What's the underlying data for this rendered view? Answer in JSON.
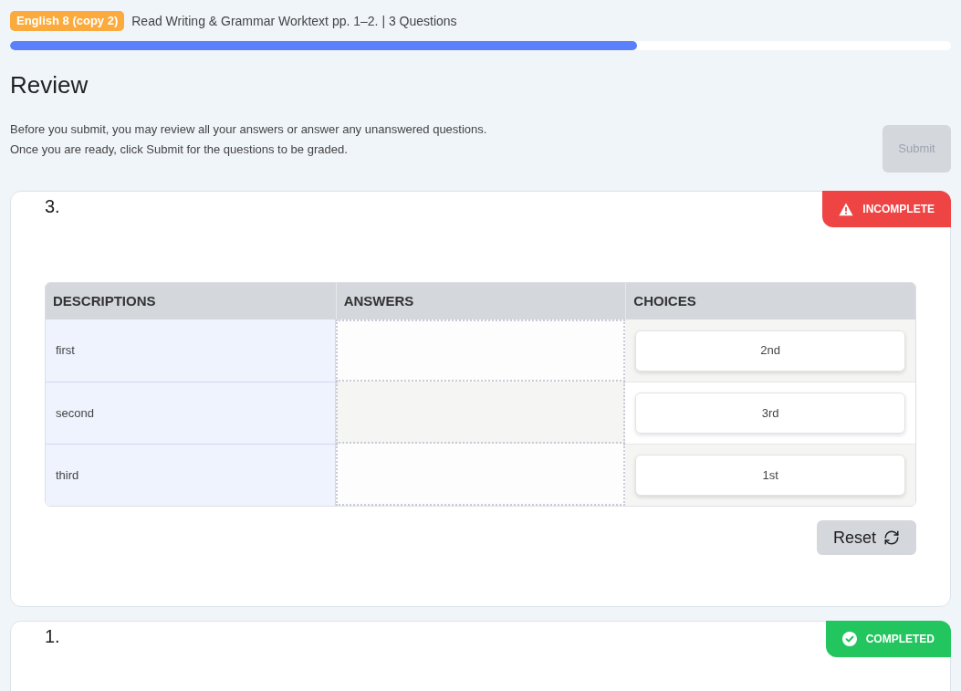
{
  "header": {
    "course_badge": "English 8 (copy 2)",
    "title": "Read Writing & Grammar Worktext pp. 1–2. | 3 Questions",
    "progress": {
      "level": 0.666
    }
  },
  "review": {
    "heading": "Review",
    "instructions": [
      "Before you submit, you may review all your answers or answer any unanswered questions.",
      "Once you are ready, click Submit for the questions to be graded."
    ],
    "submit_button": {
      "label": "Submit",
      "disabled": true
    }
  },
  "questions": [
    {
      "number": "3.",
      "status": {
        "kind": "incomplete",
        "label": "INCOMPLETE"
      },
      "matching_table": {
        "columns": [
          "DESCRIPTIONS",
          "ANSWERS",
          "CHOICES"
        ],
        "rows": [
          {
            "description": "first",
            "choice": "2nd"
          },
          {
            "description": "second",
            "choice": "3rd"
          },
          {
            "description": "third",
            "choice": "1st"
          }
        ]
      },
      "reset_button": "Reset"
    },
    {
      "number": "1.",
      "status": {
        "kind": "completed",
        "label": "COMPLETED"
      }
    }
  ]
}
